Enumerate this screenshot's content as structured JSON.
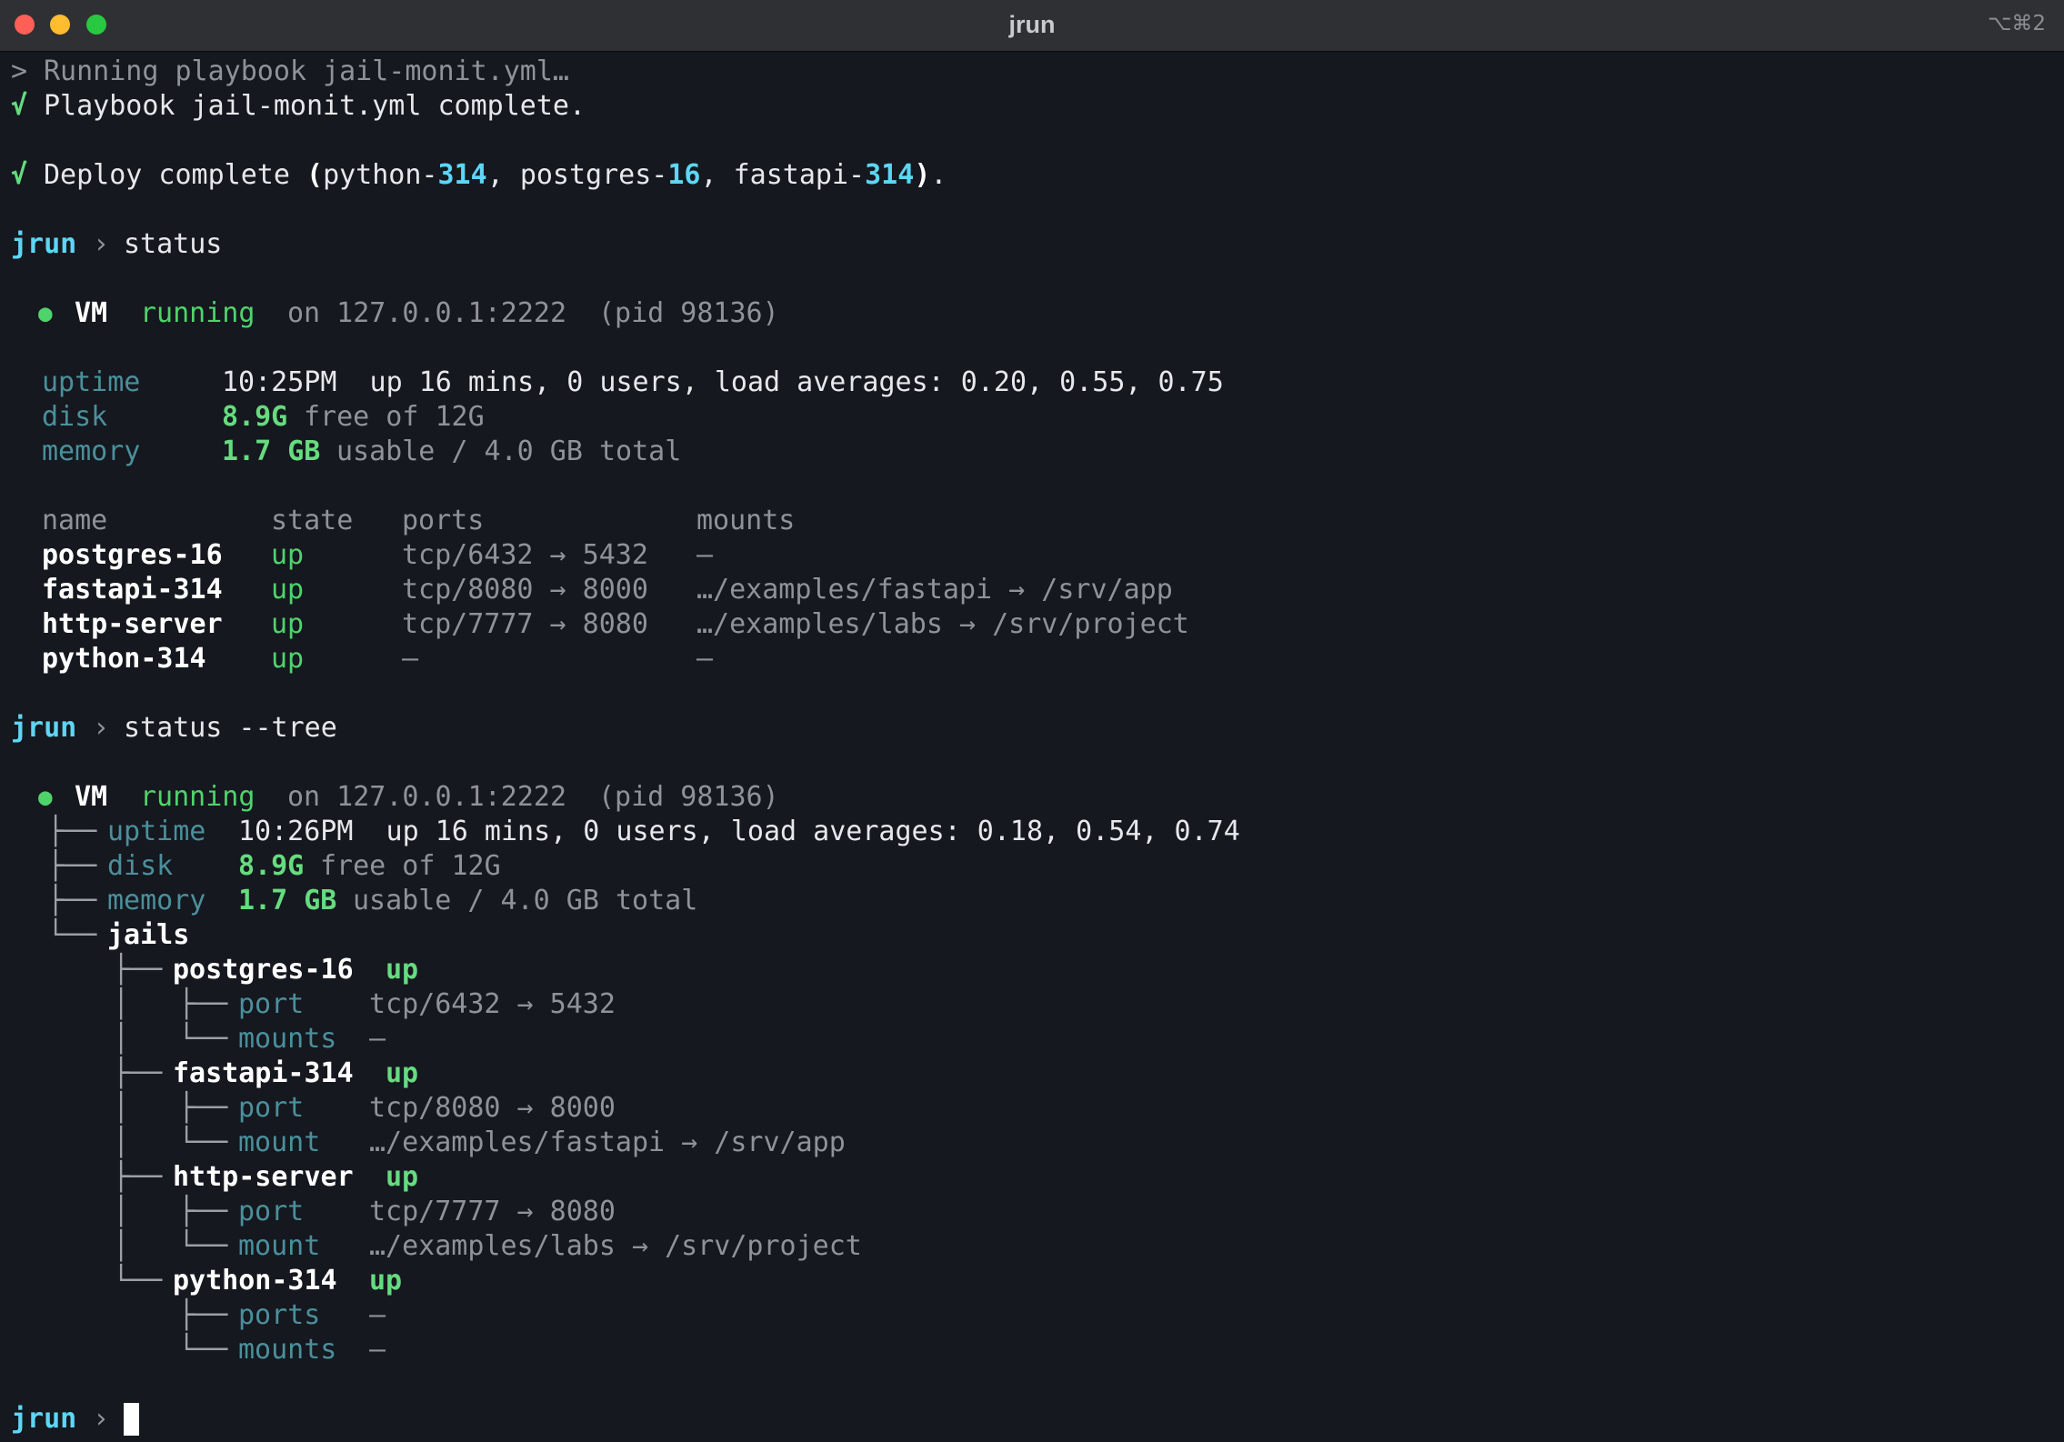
{
  "window": {
    "title": "jrun",
    "shortcut": "⌥⌘2"
  },
  "run": {
    "running_prefix": ">",
    "running_text": "Running playbook jail-monit.yml…",
    "check": "√",
    "complete_text": "Playbook jail-monit.yml complete.",
    "deploy_text": "Deploy complete",
    "deploy_items": [
      {
        "pre": "python-",
        "num": "314"
      },
      {
        "pre": "postgres-",
        "num": "16"
      },
      {
        "pre": "fastapi-",
        "num": "314"
      }
    ]
  },
  "prompt": {
    "name": "jrun",
    "sep": "›"
  },
  "status_cmd": "status",
  "tree_cmd": "status --tree",
  "status": {
    "dot": "●",
    "vm_label": "VM",
    "vm_state": "running",
    "vm_addr": "on 127.0.0.1:2222",
    "vm_pid": "(pid 98136)",
    "uptime_label": "uptime",
    "uptime_value": "10:25PM  up 16 mins, 0 users, load averages: 0.20, 0.55, 0.75",
    "disk_label": "disk",
    "disk_free": "8.9G",
    "disk_rest": "free of 12G",
    "memory_label": "memory",
    "memory_usable": "1.7 GB",
    "memory_rest": "usable / 4.0 GB total",
    "columns": [
      "name",
      "state",
      "ports",
      "mounts"
    ],
    "rows": [
      {
        "name": "postgres-16",
        "state": "up",
        "ports": "tcp/6432 → 5432",
        "mounts": "—"
      },
      {
        "name": "fastapi-314",
        "state": "up",
        "ports": "tcp/8080 → 8000",
        "mounts": "…/examples/fastapi → /srv/app"
      },
      {
        "name": "http-server",
        "state": "up",
        "ports": "tcp/7777 → 8080",
        "mounts": "…/examples/labs → /srv/project"
      },
      {
        "name": "python-314",
        "state": "up",
        "ports": "—",
        "mounts": "—"
      }
    ]
  },
  "tree": {
    "uptime_value": "10:26PM  up 16 mins, 0 users, load averages: 0.18, 0.54, 0.74",
    "jails_label": "jails",
    "jails": [
      {
        "name": "postgres-16",
        "state": "up",
        "k1": "port",
        "v1": "tcp/6432 → 5432",
        "k2": "mounts",
        "v2": "—"
      },
      {
        "name": "fastapi-314",
        "state": "up",
        "k1": "port",
        "v1": "tcp/8080 → 8000",
        "k2": "mount",
        "v2": "…/examples/fastapi → /srv/app"
      },
      {
        "name": "http-server",
        "state": "up",
        "k1": "port",
        "v1": "tcp/7777 → 8080",
        "k2": "mount",
        "v2": "…/examples/labs → /srv/project"
      },
      {
        "name": "python-314",
        "state": "up",
        "k1": "ports",
        "v1": "—",
        "k2": "mounts",
        "v2": "—"
      }
    ]
  },
  "colors": {
    "background": "#15181e",
    "cyan": "#5ed6f5",
    "green": "#4fd36b",
    "label_teal": "#4b8f9c",
    "dim": "#8f9398"
  }
}
